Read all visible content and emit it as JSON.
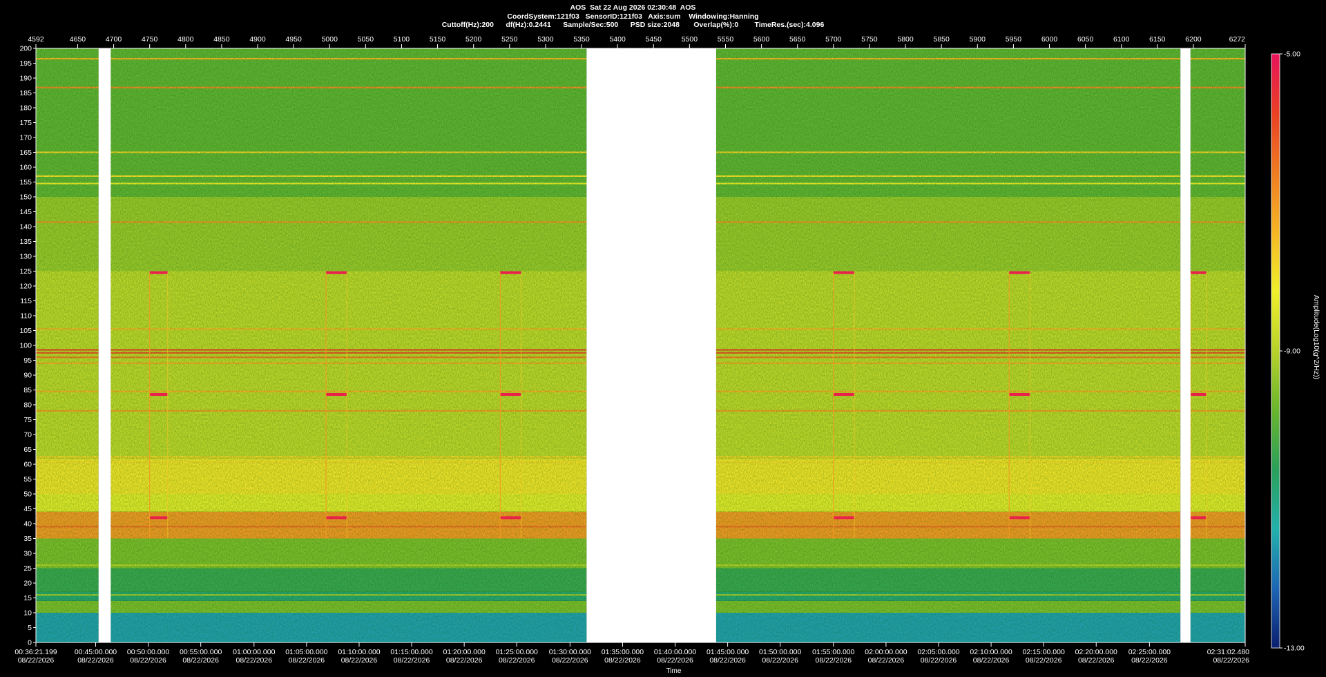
{
  "header": {
    "line1": "AOS  Sat 22 Aug 2026 02:30:48  AOS",
    "line2": "CoordSystem:121f03   SensorID:121f03   Axis:sum    Windowing:Hanning",
    "line3": "Cuttoff(Hz):200      df(Hz):0.2441      Sample/Sec:500      PSD size:2048       Overlap(%):0        TimeRes.(sec):4.096"
  },
  "colors": {
    "background": "#000000",
    "axis": "#ffffff",
    "gap": "#ffffff",
    "colormap": [
      "#0b1f6e",
      "#1e66b4",
      "#23b0ac",
      "#2aa05a",
      "#69b52d",
      "#b8d22a",
      "#f0f02a",
      "#f5b624",
      "#f07c22",
      "#ea4024",
      "#e8145a"
    ]
  },
  "chart_data": {
    "type": "heatmap",
    "title": "AOS  Sat 22 Aug 2026 02:30:48  AOS",
    "xlabel": "Time",
    "ylabel": "",
    "colorbar_label": "Amplitude(Log10(g^2/Hz))",
    "colorbar_range": [
      -13.0,
      -5.0
    ],
    "colorbar_ticks": [
      "-5.00",
      "-9.00",
      "-13.00"
    ],
    "ylim": [
      0,
      200
    ],
    "y_ticks": [
      0,
      5,
      10,
      15,
      20,
      25,
      30,
      35,
      40,
      45,
      50,
      55,
      60,
      65,
      70,
      75,
      80,
      85,
      90,
      95,
      100,
      105,
      110,
      115,
      120,
      125,
      130,
      135,
      140,
      145,
      150,
      155,
      160,
      165,
      170,
      175,
      180,
      185,
      190,
      195,
      200
    ],
    "top_axis": {
      "range": [
        4592,
        6272
      ],
      "ticks": [
        4592,
        4650,
        4700,
        4750,
        4800,
        4850,
        4900,
        4950,
        5000,
        5050,
        5100,
        5150,
        5200,
        5250,
        5300,
        5350,
        5400,
        5450,
        5500,
        5550,
        5600,
        5650,
        5700,
        5750,
        5800,
        5850,
        5900,
        5950,
        6000,
        6050,
        6100,
        6150,
        6200,
        6272
      ]
    },
    "bottom_axis": {
      "ticks": [
        {
          "pos": 4592,
          "time": "00:36:21.199",
          "date": "08/22/2026"
        },
        {
          "pos": 4675,
          "time": "00:45:00.000",
          "date": "08/22/2026"
        },
        {
          "pos": 4748,
          "time": "00:50:00.000",
          "date": "08/22/2026"
        },
        {
          "pos": 4821,
          "time": "00:55:00.000",
          "date": "08/22/2026"
        },
        {
          "pos": 4895,
          "time": "01:00:00.000",
          "date": "08/22/2026"
        },
        {
          "pos": 4968,
          "time": "01:05:00.000",
          "date": "08/22/2026"
        },
        {
          "pos": 5041,
          "time": "01:10:00.000",
          "date": "08/22/2026"
        },
        {
          "pos": 5114,
          "time": "01:15:00.000",
          "date": "08/22/2026"
        },
        {
          "pos": 5187,
          "time": "01:20:00.000",
          "date": "08/22/2026"
        },
        {
          "pos": 5260,
          "time": "01:25:00.000",
          "date": "08/22/2026"
        },
        {
          "pos": 5334,
          "time": "01:30:00.000",
          "date": "08/22/2026"
        },
        {
          "pos": 5407,
          "time": "01:35:00.000",
          "date": "08/22/2026"
        },
        {
          "pos": 5480,
          "time": "01:40:00.000",
          "date": "08/22/2026"
        },
        {
          "pos": 5553,
          "time": "01:45:00.000",
          "date": "08/22/2026"
        },
        {
          "pos": 5626,
          "time": "01:50:00.000",
          "date": "08/22/2026"
        },
        {
          "pos": 5700,
          "time": "01:55:00.000",
          "date": "08/22/2026"
        },
        {
          "pos": 5773,
          "time": "02:00:00.000",
          "date": "08/22/2026"
        },
        {
          "pos": 5846,
          "time": "02:05:00.000",
          "date": "08/22/2026"
        },
        {
          "pos": 5919,
          "time": "02:10:00.000",
          "date": "08/22/2026"
        },
        {
          "pos": 5992,
          "time": "02:15:00.000",
          "date": "08/22/2026"
        },
        {
          "pos": 6065,
          "time": "02:20:00.000",
          "date": "08/22/2026"
        },
        {
          "pos": 6139,
          "time": "02:25:00.000",
          "date": "08/22/2026"
        },
        {
          "pos": 6272,
          "time": "02:31:02.480",
          "date": "08/22/2026"
        }
      ]
    },
    "data_segments": [
      [
        4592,
        4679
      ],
      [
        4696,
        5357
      ],
      [
        5537,
        6182
      ],
      [
        6196,
        6272
      ]
    ],
    "gap_segments": [
      [
        4679,
        4696
      ],
      [
        5357,
        5537
      ],
      [
        6182,
        6196
      ]
    ],
    "bands": [
      {
        "lo": 0,
        "hi": 10,
        "level": -11.6
      },
      {
        "lo": 10,
        "hi": 14,
        "level": -9.6
      },
      {
        "lo": 14,
        "hi": 17,
        "level": -10.8
      },
      {
        "lo": 17,
        "hi": 25,
        "level": -10.4
      },
      {
        "lo": 25,
        "hi": 35,
        "level": -9.6
      },
      {
        "lo": 35,
        "hi": 44,
        "level": -7.0
      },
      {
        "lo": 44,
        "hi": 50,
        "level": -8.4
      },
      {
        "lo": 50,
        "hi": 62,
        "level": -8.0
      },
      {
        "lo": 62,
        "hi": 125,
        "level": -8.9
      },
      {
        "lo": 125,
        "hi": 150,
        "level": -9.3
      },
      {
        "lo": 150,
        "hi": 200,
        "level": -9.9
      }
    ],
    "lines": [
      {
        "hz": 196.5,
        "level": -7.4
      },
      {
        "hz": 186.8,
        "level": -6.8
      },
      {
        "hz": 165.0,
        "level": -7.8
      },
      {
        "hz": 157.0,
        "level": -8.0
      },
      {
        "hz": 154.5,
        "level": -8.2
      },
      {
        "hz": 141.5,
        "level": -6.9
      },
      {
        "hz": 105.5,
        "level": -7.4
      },
      {
        "hz": 98.5,
        "level": -5.9
      },
      {
        "hz": 97.5,
        "level": -6.0
      },
      {
        "hz": 96.0,
        "level": -6.6
      },
      {
        "hz": 94.0,
        "level": -7.2
      },
      {
        "hz": 84.5,
        "level": -7.3
      },
      {
        "hz": 78.0,
        "level": -7.0
      },
      {
        "hz": 62.5,
        "level": -7.8
      },
      {
        "hz": 60.5,
        "level": -7.9
      },
      {
        "hz": 39.0,
        "level": -6.4
      },
      {
        "hz": 26.0,
        "level": -9.0
      },
      {
        "hz": 16.0,
        "level": -9.2
      }
    ],
    "events": [
      {
        "x0": 4750,
        "x1": 4775,
        "freqs": [
          124.5,
          83.5,
          42.0
        ],
        "level": -5.2
      },
      {
        "x0": 4995,
        "x1": 5024,
        "freqs": [
          124.5,
          83.5,
          42.0
        ],
        "level": -5.2
      },
      {
        "x0": 5237,
        "x1": 5266,
        "freqs": [
          124.5,
          83.5,
          42.0
        ],
        "level": -5.2
      },
      {
        "x0": 5700,
        "x1": 5729,
        "freqs": [
          124.5,
          83.5,
          42.0
        ],
        "level": -5.2
      },
      {
        "x0": 5944,
        "x1": 5973,
        "freqs": [
          124.5,
          83.5,
          42.0
        ],
        "level": -5.2
      },
      {
        "x0": 6196,
        "x1": 6218,
        "freqs": [
          124.5,
          83.5,
          42.0
        ],
        "level": -5.2
      }
    ]
  }
}
